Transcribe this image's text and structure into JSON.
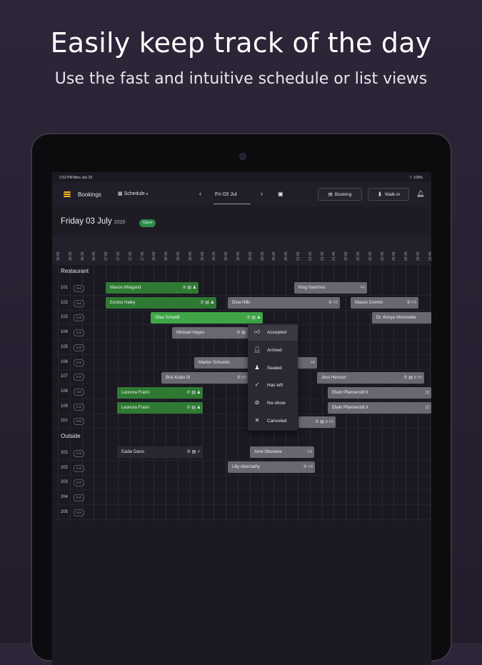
{
  "promo": {
    "headline": "Easily keep track of the day",
    "subline": "Use the fast and intuitive schedule or list views"
  },
  "status": {
    "time": "2:52 PM  Mon Jun 29",
    "battery": "100%"
  },
  "appbar": {
    "title": "Bookings",
    "view": "Schedule",
    "date": "Fri 03 Jul",
    "booking_btn": "Booking",
    "walkin_btn": "Walk-in"
  },
  "day": {
    "title": "Friday 03 July",
    "year": "2020",
    "status": "Open"
  },
  "times": [
    "16:00",
    "16:15",
    "16:30",
    "16:45",
    "17:00",
    "17:15",
    "17:30",
    "17:45",
    "18:00",
    "18:15",
    "18:30",
    "18:45",
    "19:00",
    "19:15",
    "19:30",
    "19:45",
    "20:00",
    "20:15",
    "20:30",
    "20:45",
    "21:00",
    "21:15",
    "21:30",
    "21:45",
    "22:00",
    "22:15",
    "22:30",
    "22:45",
    "23:00",
    "23:15",
    "23:30",
    "23:45"
  ],
  "sections": [
    {
      "name": "Restaurant",
      "rows": [
        {
          "table": "101",
          "cap": "2-4"
        },
        {
          "table": "102",
          "cap": "2-4"
        },
        {
          "table": "103",
          "cap": "1-3"
        },
        {
          "table": "104",
          "cap": "1-2"
        },
        {
          "table": "105",
          "cap": "1-2"
        },
        {
          "table": "106",
          "cap": "1-3"
        },
        {
          "table": "107",
          "cap": "2-4"
        },
        {
          "table": "108",
          "cap": "1-2"
        },
        {
          "table": "109",
          "cap": "1-2"
        },
        {
          "table": "110",
          "cap": "2-6"
        }
      ]
    },
    {
      "name": "Outside",
      "rows": [
        {
          "table": "201",
          "cap": "1-3"
        },
        {
          "table": "202",
          "cap": "1-3"
        },
        {
          "table": "203",
          "cap": "1-2"
        },
        {
          "table": "204",
          "cap": "2-4"
        },
        {
          "table": "205",
          "cap": "1-2"
        }
      ]
    }
  ],
  "bookings": {
    "b1": "Mason Wiegand",
    "b2": "King Hammes",
    "b3": "Eunice Haley",
    "b4": "Dina Hills",
    "b5": "Mason Cremin",
    "b6": "Silas Schaldt",
    "b7": "Dr. Kenya Morissette",
    "b8": "Michael Hayes",
    "b9": "Marlon Schumm",
    "b10": "Bria Kulas III",
    "b11": "Jess Henson",
    "b12": "Leonora Frami",
    "b13": "Elwin Pfannerstill II",
    "b14": "Leonora Frami",
    "b15": "Elwin Pfannerstill II",
    "b16": "Eadie Davis",
    "b17": "Arne Okuneva",
    "b18": "Lilly Abernathy"
  },
  "menu": [
    "Accepted",
    "Arrived",
    "Seated",
    "Has left",
    "No-show",
    "Canceled"
  ],
  "colors": {
    "accent": "#f2b822",
    "booked_green": "#2f7a33",
    "open_badge": "#2c8a4d"
  }
}
